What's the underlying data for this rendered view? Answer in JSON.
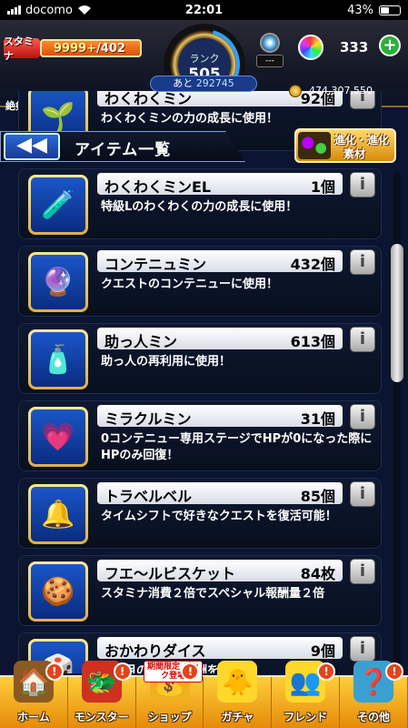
{
  "status_bar": {
    "carrier": "docomo",
    "time": "22:01",
    "battery": "43%",
    "battery_level": 0.43
  },
  "header": {
    "stamina_label": "スタミナ",
    "stamina_value": "9999+",
    "stamina_max": "/402",
    "rank_label": "ランク",
    "rank_value": "505",
    "gem_slot": "---",
    "orb_count": "333",
    "orb_add": "+",
    "zekken_label": "絶剣",
    "next_rank_prefix": "あと",
    "next_rank_value": "292745",
    "gold": "474,307,550"
  },
  "title_bar": {
    "back_icon": "◀◀",
    "title": "アイテム一覧",
    "evolution_line1": "進化・進化",
    "evolution_line2": "素材"
  },
  "items": [
    {
      "name": "わくわくミン",
      "count": "92個",
      "desc": "わくわくミンの力の成長に使用！",
      "icon": "🌱",
      "partial": true
    },
    {
      "name": "わくわくミンEL",
      "count": "1個",
      "desc": "特級Lのわくわくの力の成長に使用！",
      "icon": "🧪"
    },
    {
      "name": "コンテニュミン",
      "count": "432個",
      "desc": "クエストのコンテニューに使用！",
      "icon": "🔮"
    },
    {
      "name": "助っ人ミン",
      "count": "613個",
      "desc": "助っ人の再利用に使用！",
      "icon": "🧴"
    },
    {
      "name": "ミラクルミン",
      "count": "31個",
      "desc": "0コンテニュー専用ステージでHPが0になった際にHPのみ回復！",
      "icon": "💗"
    },
    {
      "name": "トラベルベル",
      "count": "85個",
      "desc": "タイムシフトで好きなクエストを復活可能！",
      "icon": "🔔"
    },
    {
      "name": "フエ〜ルビスケット",
      "count": "84枚",
      "desc": "スタミナ消費２倍でスペシャル報酬量２倍",
      "icon": "🍪"
    },
    {
      "name": "おかわりダイス",
      "count": "9個",
      "desc": "出た目の数だけ報酬を追加！",
      "icon": "🎲"
    }
  ],
  "scrollbar": {
    "position": 0.17
  },
  "bottom_nav": {
    "tabs": [
      {
        "label": "ホーム",
        "icon": "🏠",
        "badge": "!"
      },
      {
        "label": "モンスター",
        "icon": "🐲",
        "badge": "!"
      },
      {
        "label": "ショップ",
        "icon": "💰",
        "badge": "!",
        "sale": "期間限定 パック登場"
      },
      {
        "label": "ガチャ",
        "icon": "🐥",
        "badge": ""
      },
      {
        "label": "フレンド",
        "icon": "👥",
        "badge": "!"
      },
      {
        "label": "その他",
        "icon": "❓",
        "badge": "!"
      }
    ]
  }
}
